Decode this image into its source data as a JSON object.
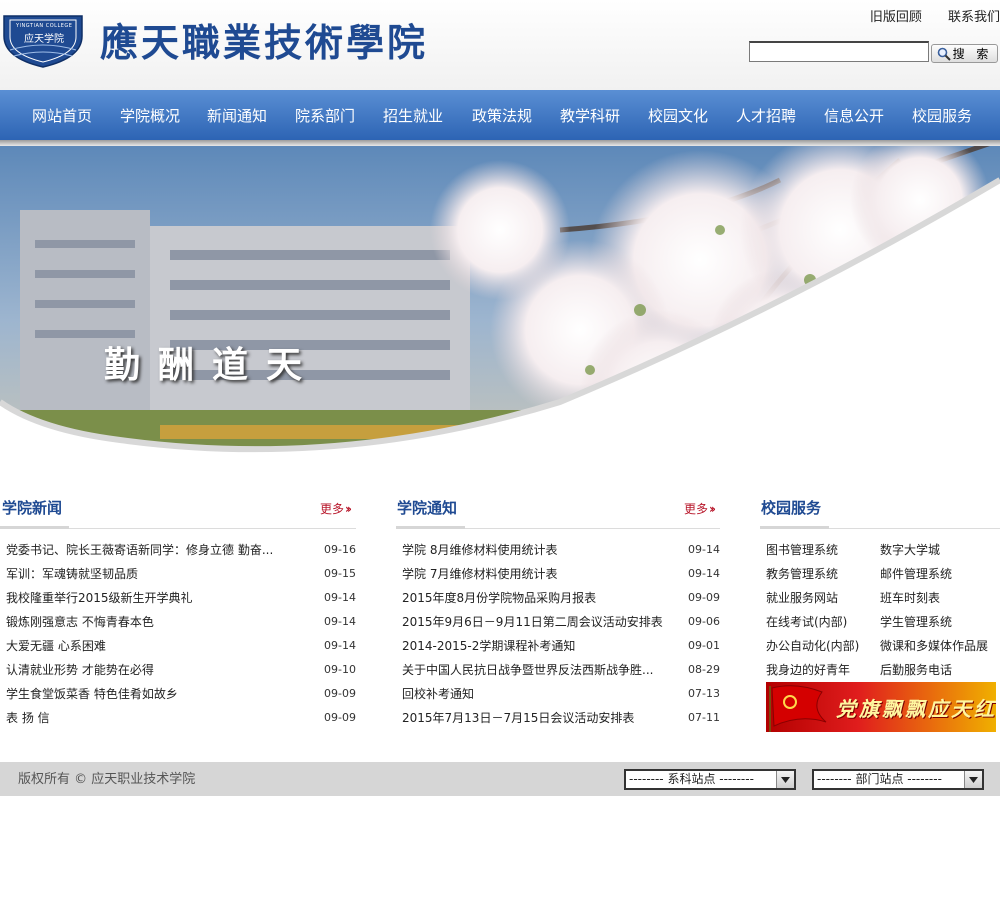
{
  "header": {
    "logo_text": "應天職業技術學院",
    "logo_badge_top": "YINGTIAN COLLEGE",
    "logo_badge_text": "应天学院",
    "top_links": [
      "旧版回顾",
      "联系我们"
    ],
    "search_placeholder": "",
    "search_button": "搜 索"
  },
  "nav": {
    "items": [
      "网站首页",
      "学院概况",
      "新闻通知",
      "院系部门",
      "招生就业",
      "政策法规",
      "教学科研",
      "校园文化",
      "人才招聘",
      "信息公开",
      "校园服务"
    ]
  },
  "banner": {
    "slogan": "勤酬道天"
  },
  "news": {
    "title": "学院新闻",
    "more": "更多",
    "items": [
      {
        "title": "党委书记、院长王薇寄语新同学：修身立德 勤奋...",
        "date": "09-16"
      },
      {
        "title": "军训：军魂铸就坚韧品质",
        "date": "09-15"
      },
      {
        "title": "我校隆重举行2015级新生开学典礼",
        "date": "09-14"
      },
      {
        "title": "锻炼刚强意志 不悔青春本色",
        "date": "09-14"
      },
      {
        "title": "大爱无疆 心系困难",
        "date": "09-14"
      },
      {
        "title": "认清就业形势 才能势在必得",
        "date": "09-10"
      },
      {
        "title": "学生食堂饭菜香 特色佳肴如故乡",
        "date": "09-09"
      },
      {
        "title": "表 扬 信",
        "date": "09-09"
      }
    ]
  },
  "notices": {
    "title": "学院通知",
    "more": "更多",
    "items": [
      {
        "title": "学院 8月维修材料使用统计表",
        "date": "09-14"
      },
      {
        "title": "学院 7月维修材料使用统计表",
        "date": "09-14"
      },
      {
        "title": "2015年度8月份学院物品采购月报表",
        "date": "09-09"
      },
      {
        "title": "2015年9月6日－9月11日第二周会议活动安排表",
        "date": "09-06"
      },
      {
        "title": "2014-2015-2学期课程补考通知",
        "date": "09-01"
      },
      {
        "title": "关于中国人民抗日战争暨世界反法西斯战争胜...",
        "date": "08-29"
      },
      {
        "title": "回校补考通知",
        "date": "07-13"
      },
      {
        "title": "2015年7月13日－7月15日会议活动安排表",
        "date": "07-11"
      }
    ]
  },
  "services": {
    "title": "校园服务",
    "items": [
      "图书管理系统",
      "数字大学城",
      "教务管理系统",
      "邮件管理系统",
      "就业服务网站",
      "班车时刻表",
      "在线考试(内部)",
      "学生管理系统",
      "办公自动化(内部)",
      "微课和多媒体作品展",
      "我身边的好青年",
      "后勤服务电话"
    ],
    "banner_text": "党旗飘飘应天红"
  },
  "footer": {
    "copyright": "版权所有 © 应天职业技术学院",
    "select_dept_sites": "-------- 系科站点 --------",
    "select_office_sites": "-------- 部门站点 --------"
  },
  "colors": {
    "nav_top": "#5a8fd4",
    "nav_bottom": "#2d64b4",
    "heading_blue": "#1f4a92",
    "more_red": "#b8172b",
    "footer_bg": "#d6d6d6"
  }
}
